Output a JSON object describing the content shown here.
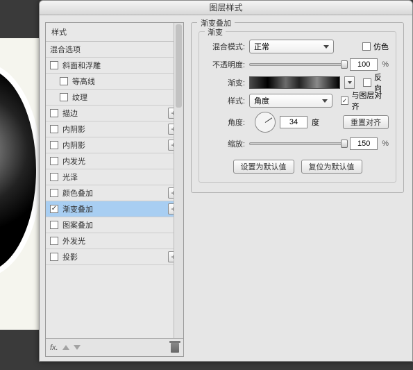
{
  "dialog_title": "图层样式",
  "left": {
    "header": "样式",
    "blend_options": "混合选项",
    "items": [
      {
        "label": "斜面和浮雕",
        "checked": false,
        "expand": false
      },
      {
        "label": "等高线",
        "checked": false,
        "expand": false,
        "sub": true
      },
      {
        "label": "纹理",
        "checked": false,
        "expand": false,
        "sub": true
      },
      {
        "label": "描边",
        "checked": false,
        "expand": true
      },
      {
        "label": "内阴影",
        "checked": false,
        "expand": true
      },
      {
        "label": "内阴影",
        "checked": false,
        "expand": true
      },
      {
        "label": "内发光",
        "checked": false,
        "expand": false
      },
      {
        "label": "光泽",
        "checked": false,
        "expand": false
      },
      {
        "label": "颜色叠加",
        "checked": false,
        "expand": true
      },
      {
        "label": "渐变叠加",
        "checked": true,
        "expand": true,
        "selected": true
      },
      {
        "label": "图案叠加",
        "checked": false,
        "expand": false
      },
      {
        "label": "外发光",
        "checked": false,
        "expand": false
      },
      {
        "label": "投影",
        "checked": false,
        "expand": true
      }
    ],
    "fx": "fx"
  },
  "right": {
    "group_title": "渐变叠加",
    "inner_title": "渐变",
    "blend_mode_label": "混合模式:",
    "blend_mode_value": "正常",
    "dither_label": "仿色",
    "opacity_label": "不透明度:",
    "opacity_value": "100",
    "gradient_label": "渐变:",
    "reverse_label": "反向",
    "style_label": "样式:",
    "style_value": "角度",
    "align_label": "与图层对齐",
    "angle_label": "角度:",
    "angle_value": "34",
    "degree": "度",
    "reset_align": "重置对齐",
    "scale_label": "缩放:",
    "scale_value": "150",
    "pct": "%",
    "make_default": "设置为默认值",
    "reset_default": "复位为默认值"
  }
}
